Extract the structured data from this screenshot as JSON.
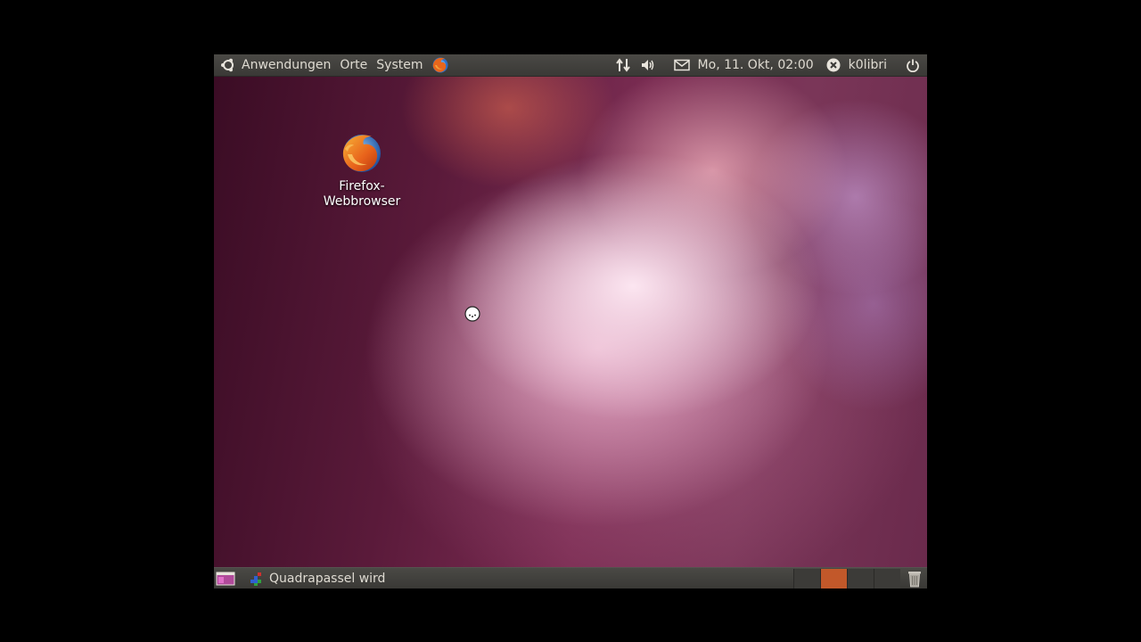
{
  "top_panel": {
    "menu": [
      "Anwendungen",
      "Orte",
      "System"
    ],
    "clock": "Mo, 11. Okt, 02:00",
    "user": "k0libri",
    "icons": [
      "ubuntu-logo-icon",
      "firefox-launcher-icon",
      "network-icon",
      "volume-icon",
      "mail-icon",
      "user-status-icon",
      "power-icon"
    ]
  },
  "desktop": {
    "icons": [
      {
        "label_line1": "Firefox-",
        "label_line2": "Webbrowser",
        "icon": "firefox-icon"
      }
    ]
  },
  "bottom_panel": {
    "tasks": [
      {
        "label": "Quadrapassel wird ges…",
        "icon": "quadrapassel-icon"
      }
    ],
    "workspaces": 4,
    "active_workspace": 2,
    "icons": [
      "show-desktop-icon",
      "trash-icon"
    ]
  },
  "colors": {
    "panel": "#3c3b38",
    "active_workspace": "#c2582a"
  }
}
